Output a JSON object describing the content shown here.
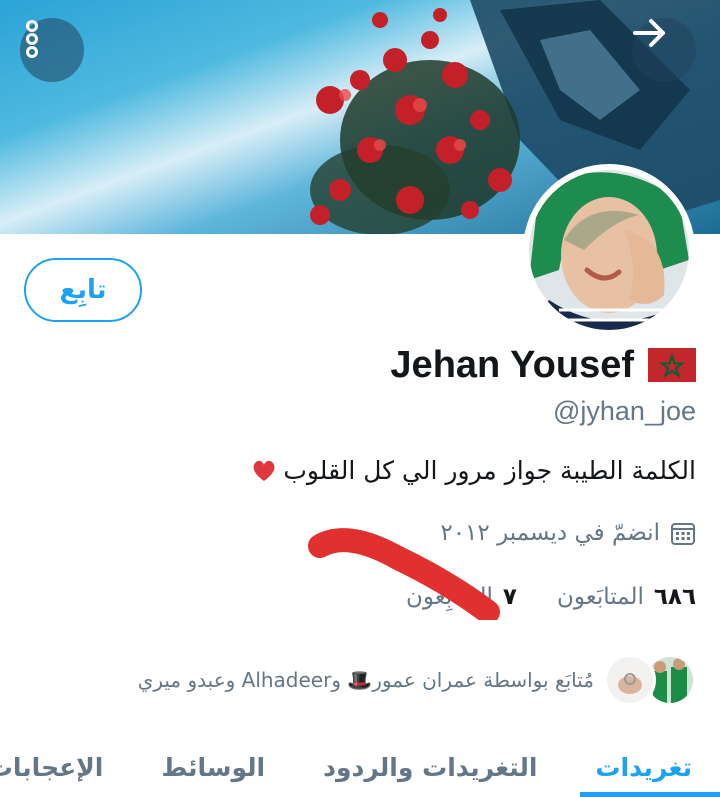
{
  "header": {
    "menu_icon": "vertical-dots-icon",
    "back_icon": "arrow-right-icon"
  },
  "profile": {
    "display_name": "Jehan Yousef",
    "flag_icon": "morocco-flag-icon",
    "handle": "@jyhan_joe",
    "bio": "الكلمة الطيبة جواز مرور الي كل القلوب",
    "bio_emoji": "heart-icon",
    "joined": "انضمّ في ديسمبر ٢٠١٢",
    "follow_label": "تابِع"
  },
  "stats": {
    "following_count": "٦٨٦",
    "following_label": "المتابَعون",
    "followers_count": "٧",
    "followers_label": "المتابِعون"
  },
  "followed_by": {
    "text": "مُتابَع بواسطة عمران عمور🎩 وAlhadeer وعبدو ميري"
  },
  "tabs": [
    {
      "label": "تغريدات",
      "active": true
    },
    {
      "label": "التغريدات والردود",
      "active": false
    },
    {
      "label": "الوسائط",
      "active": false
    },
    {
      "label": "الإعجابات",
      "active": false
    }
  ],
  "colors": {
    "accent": "#1da1f2",
    "muted_text": "#657786",
    "primary_text": "#14171a",
    "scribble": "#e03030"
  }
}
